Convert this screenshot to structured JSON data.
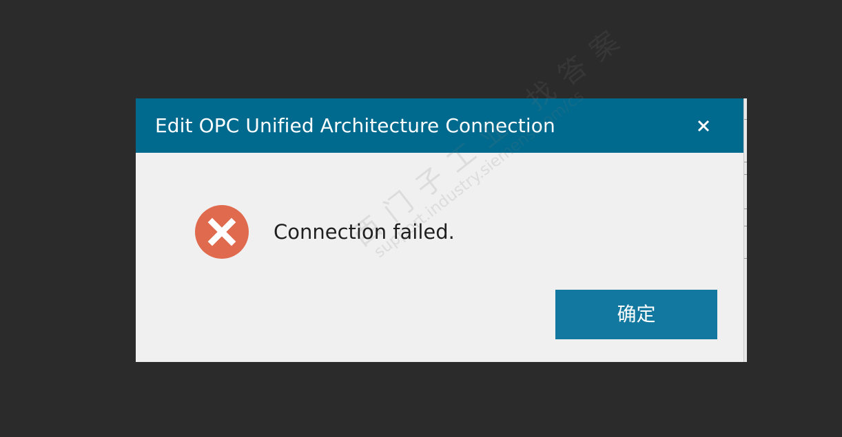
{
  "dialog": {
    "title": "Edit OPC Unified Architecture Connection",
    "close_icon": "close-icon",
    "message_icon": "error-icon",
    "message": "Connection failed.",
    "ok_label": "确定"
  },
  "watermark": {
    "text_cn": "西门子工业 找答案",
    "text_url": "support.industry.siemens.com/cs"
  },
  "colors": {
    "background": "#2b2b2b",
    "titlebar": "#006a8e",
    "dialog_body": "#f0f0f0",
    "ok_button": "#12789f",
    "error_icon": "#e06a4d"
  }
}
